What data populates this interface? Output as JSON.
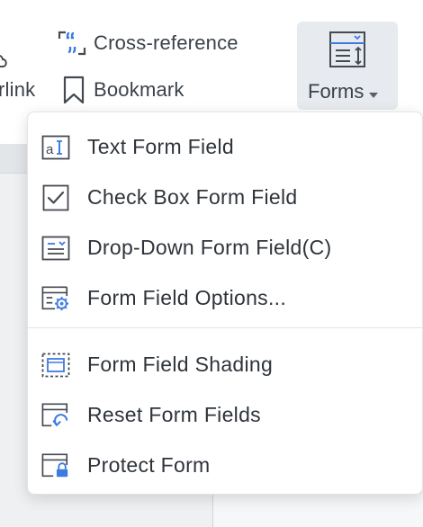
{
  "ribbon": {
    "hyperlink_label_partial": "rlink",
    "crossref_label": "Cross-reference",
    "bookmark_label": "Bookmark",
    "forms_label": "Forms"
  },
  "menu": {
    "items": [
      {
        "label": "Text Form Field",
        "icon": "text-form-field-icon"
      },
      {
        "label": "Check Box Form Field",
        "icon": "checkbox-form-field-icon"
      },
      {
        "label": "Drop-Down Form Field(C)",
        "icon": "dropdown-form-field-icon"
      },
      {
        "label": "Form Field Options...",
        "icon": "form-field-options-icon"
      },
      {
        "label": "Form Field Shading",
        "icon": "form-field-shading-icon"
      },
      {
        "label": "Reset Form Fields",
        "icon": "reset-form-fields-icon"
      },
      {
        "label": "Protect Form",
        "icon": "protect-form-icon"
      }
    ]
  },
  "colors": {
    "accent": "#3c7be0",
    "icon_dark": "#454a52",
    "text": "#2f343b",
    "forms_button_bg": "#e7eaee"
  }
}
